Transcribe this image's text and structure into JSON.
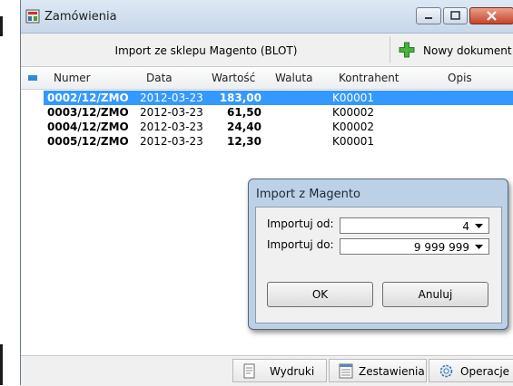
{
  "window": {
    "title": "Zamówienia"
  },
  "toolbar": {
    "import_label": "Import ze sklepu Magento (BLOT)",
    "new_document_label": "Nowy dokument"
  },
  "grid": {
    "columns": [
      "Numer",
      "Data",
      "Wartość",
      "Waluta",
      "Kontrahent",
      "Opis"
    ],
    "rows": [
      {
        "numer": "0002/12/ZMO",
        "data": "2012-03-23",
        "wartosc": "183,00",
        "waluta": "",
        "kontrahent": "K00001",
        "opis": "",
        "selected": true
      },
      {
        "numer": "0003/12/ZMO",
        "data": "2012-03-23",
        "wartosc": "61,50",
        "waluta": "",
        "kontrahent": "K00002",
        "opis": "",
        "selected": false
      },
      {
        "numer": "0004/12/ZMO",
        "data": "2012-03-23",
        "wartosc": "24,40",
        "waluta": "",
        "kontrahent": "K00002",
        "opis": "",
        "selected": false
      },
      {
        "numer": "0005/12/ZMO",
        "data": "2012-03-23",
        "wartosc": "12,30",
        "waluta": "",
        "kontrahent": "K00001",
        "opis": "",
        "selected": false
      }
    ]
  },
  "dialog": {
    "title": "Import z Magento",
    "from_label": "Importuj od:",
    "from_value": "4",
    "to_label": "Importuj do:",
    "to_value": "9 999 999",
    "ok_label": "OK",
    "cancel_label": "Anuluj"
  },
  "statusbar": {
    "print_label": "Wydruki",
    "reports_label": "Zestawienia",
    "operations_label": "Operacje"
  },
  "colors": {
    "selection": "#3399ff",
    "accent": "#2f8ad6",
    "dialog_frame": "#bcd1e6"
  }
}
